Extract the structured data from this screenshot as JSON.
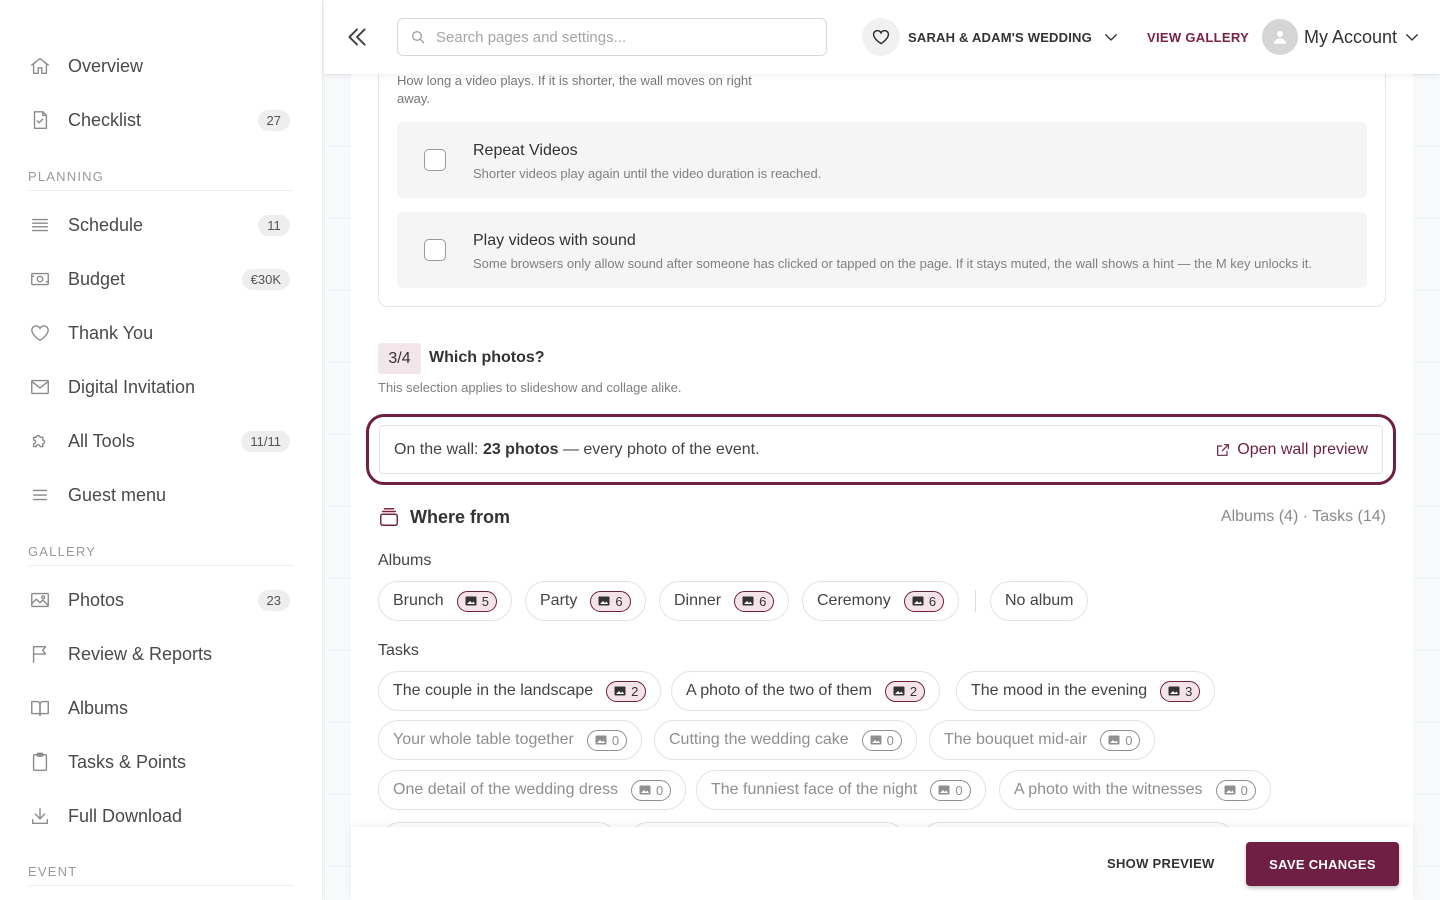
{
  "sidebar": {
    "items_top": [
      {
        "label": "Overview",
        "icon": "home-icon",
        "badge": ""
      },
      {
        "label": "Checklist",
        "icon": "checklist-icon",
        "badge": "27"
      }
    ],
    "planning": {
      "title": "PLANNING",
      "items": [
        {
          "label": "Schedule",
          "icon": "list-icon",
          "badge": "11"
        },
        {
          "label": "Budget",
          "icon": "money-icon",
          "badge": "€30K"
        },
        {
          "label": "Thank You",
          "icon": "heart-icon",
          "badge": ""
        },
        {
          "label": "Digital Invitation",
          "icon": "mail-icon",
          "badge": ""
        },
        {
          "label": "All Tools",
          "icon": "puzzle-icon",
          "badge": "11/11"
        },
        {
          "label": "Guest menu",
          "icon": "menu-icon",
          "badge": ""
        }
      ]
    },
    "gallery": {
      "title": "GALLERY",
      "items": [
        {
          "label": "Photos",
          "icon": "image-icon",
          "badge": "23"
        },
        {
          "label": "Review & Reports",
          "icon": "flag-icon",
          "badge": ""
        },
        {
          "label": "Albums",
          "icon": "book-icon",
          "badge": ""
        },
        {
          "label": "Tasks & Points",
          "icon": "clipboard-icon",
          "badge": ""
        },
        {
          "label": "Full Download",
          "icon": "download-icon",
          "badge": ""
        }
      ]
    },
    "event": {
      "title": "EVENT"
    }
  },
  "topbar": {
    "search_placeholder": "Search pages and settings...",
    "event_name": "SARAH & ADAM'S WEDDING",
    "view_gallery": "VIEW GALLERY",
    "account": "My Account"
  },
  "video_options": {
    "duration_help": "How long a video plays. If it is shorter, the wall moves on right away.",
    "repeat": {
      "title": "Repeat Videos",
      "desc": "Shorter videos play again until the video duration is reached.",
      "checked": false
    },
    "sound": {
      "title": "Play videos with sound",
      "desc": "Some browsers only allow sound after someone has clicked or tapped on the page. If it stays muted, the wall shows a hint — the M key unlocks it.",
      "checked": false
    }
  },
  "which_photos": {
    "step": "3/4",
    "title": "Which photos?",
    "subtitle": "This selection applies to slideshow and collage alike.",
    "wall_prefix": "On the wall: ",
    "wall_count": "23 photos",
    "wall_suffix": " — every photo of the event.",
    "open_preview": "Open wall preview"
  },
  "where_from": {
    "title": "Where from",
    "summary": "Albums (4) · Tasks (14)",
    "albums_label": "Albums",
    "albums": [
      {
        "label": "Brunch",
        "count": "5"
      },
      {
        "label": "Party",
        "count": "6"
      },
      {
        "label": "Dinner",
        "count": "6"
      },
      {
        "label": "Ceremony",
        "count": "6"
      }
    ],
    "no_album": "No album",
    "tasks_label": "Tasks",
    "tasks": [
      {
        "label": "The couple in the landscape",
        "count": "2"
      },
      {
        "label": "A photo of the two of them",
        "count": "2"
      },
      {
        "label": "The mood in the evening",
        "count": "3"
      },
      {
        "label": "Your whole table together",
        "count": "0"
      },
      {
        "label": "Cutting the wedding cake",
        "count": "0"
      },
      {
        "label": "The bouquet mid-air",
        "count": "0"
      },
      {
        "label": "One detail of the wedding dress",
        "count": "0"
      },
      {
        "label": "The funniest face of the night",
        "count": "0"
      },
      {
        "label": "A photo with the witnesses",
        "count": "0"
      }
    ]
  },
  "footer": {
    "show_preview": "SHOW PREVIEW",
    "save": "SAVE CHANGES"
  },
  "colors": {
    "accent": "#6e1f43",
    "accent_light": "#f4e4ea"
  }
}
